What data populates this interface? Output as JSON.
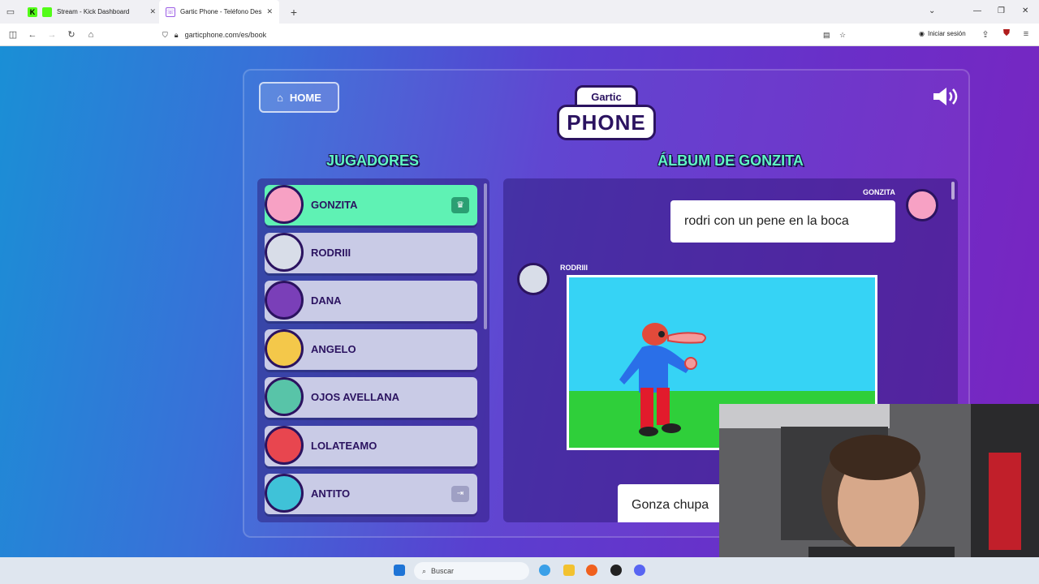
{
  "browser": {
    "tabs": [
      {
        "title": "Stream - Kick Dashboard",
        "active": false
      },
      {
        "title": "Gartic Phone - Teléfono Descon",
        "active": true
      }
    ],
    "new_tab": "+",
    "url": "garticphone.com/es/book",
    "signin_label": "Iniciar sesión"
  },
  "page": {
    "home_label": "HOME",
    "logo_top": "Gartic",
    "logo_bottom": "PHONE",
    "players_heading": "JUGADORES",
    "album_heading": "ÁLBUM DE GONZITA",
    "players": [
      {
        "name": "GONZITA",
        "active": true,
        "badge": "crown",
        "color": "#f7a1c4"
      },
      {
        "name": "RODRIII",
        "active": false,
        "badge": "",
        "color": "#d8dde8"
      },
      {
        "name": "DANA",
        "active": false,
        "badge": "",
        "color": "#7a3fb8"
      },
      {
        "name": "ANGELO",
        "active": false,
        "badge": "",
        "color": "#f4c84a"
      },
      {
        "name": "OJOS AVELLANA",
        "active": false,
        "badge": "",
        "color": "#58c4a8"
      },
      {
        "name": "LOLATEAMO",
        "active": false,
        "badge": "",
        "color": "#e8464f"
      },
      {
        "name": "ANTITO",
        "active": false,
        "badge": "exit",
        "color": "#3fc2d8"
      }
    ],
    "album": {
      "entries": [
        {
          "author": "GONZITA",
          "text": "rodri con un pene en la boca"
        },
        {
          "author": "RODRIII",
          "type": "drawing"
        },
        {
          "author": "",
          "text": "Gonza chupa"
        }
      ]
    }
  },
  "taskbar": {
    "search_placeholder": "Buscar"
  }
}
